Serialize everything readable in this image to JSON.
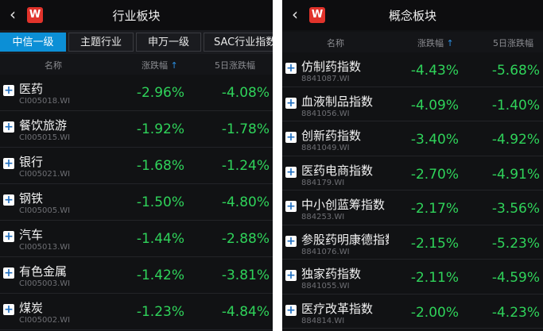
{
  "left": {
    "title": "行业板块",
    "back_icon": "‹",
    "logo_text": "W",
    "tabs": [
      "中信一级",
      "主题行业",
      "申万一级",
      "SAC行业指数"
    ],
    "active_tab": 0,
    "headers": {
      "name": "名称",
      "change": "涨跌幅",
      "change_arrow": "↑",
      "five_day": "5日涨跌幅"
    },
    "rows": [
      {
        "name": "医药",
        "code": "CI005018.WI",
        "change": "-2.96%",
        "five_day": "-4.08%"
      },
      {
        "name": "餐饮旅游",
        "code": "CI005015.WI",
        "change": "-1.92%",
        "five_day": "-1.78%"
      },
      {
        "name": "银行",
        "code": "CI005021.WI",
        "change": "-1.68%",
        "five_day": "-1.24%"
      },
      {
        "name": "钢铁",
        "code": "CI005005.WI",
        "change": "-1.50%",
        "five_day": "-4.80%"
      },
      {
        "name": "汽车",
        "code": "CI005013.WI",
        "change": "-1.44%",
        "five_day": "-2.88%"
      },
      {
        "name": "有色金属",
        "code": "CI005003.WI",
        "change": "-1.42%",
        "five_day": "-3.81%"
      },
      {
        "name": "煤炭",
        "code": "CI005002.WI",
        "change": "-1.23%",
        "five_day": "-4.84%"
      }
    ]
  },
  "right": {
    "title": "概念板块",
    "back_icon": "‹",
    "logo_text": "W",
    "headers": {
      "name": "名称",
      "change": "涨跌幅",
      "change_arrow": "↑",
      "five_day": "5日涨跌幅"
    },
    "rows": [
      {
        "name": "仿制药指数",
        "code": "8841087.WI",
        "change": "-4.43%",
        "five_day": "-5.68%"
      },
      {
        "name": "血液制品指数",
        "code": "8841056.WI",
        "change": "-4.09%",
        "five_day": "-1.40%"
      },
      {
        "name": "创新药指数",
        "code": "8841049.WI",
        "change": "-3.40%",
        "five_day": "-4.92%"
      },
      {
        "name": "医药电商指数",
        "code": "884179.WI",
        "change": "-2.70%",
        "five_day": "-4.91%"
      },
      {
        "name": "中小创蓝筹指数",
        "code": "884253.WI",
        "change": "-2.17%",
        "five_day": "-3.56%"
      },
      {
        "name": "参股药明康德指数",
        "code": "8841076.WI",
        "change": "-2.15%",
        "five_day": "-5.23%"
      },
      {
        "name": "独家药指数",
        "code": "8841055.WI",
        "change": "-2.11%",
        "five_day": "-4.59%"
      },
      {
        "name": "医疗改革指数",
        "code": "884814.WI",
        "change": "-2.00%",
        "five_day": "-4.23%"
      }
    ]
  },
  "colors": {
    "negative": "#2fd35a",
    "accent": "#0c8fd6",
    "logo": "#e1332b"
  }
}
